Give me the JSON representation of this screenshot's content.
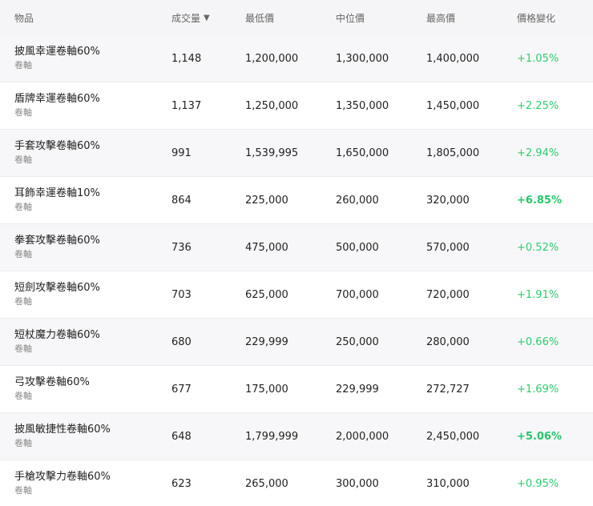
{
  "header": {
    "item": "物品",
    "volume": "成交量",
    "sort_icon": "▼",
    "low": "最低價",
    "median": "中位價",
    "high": "最高價",
    "change": "價格變化"
  },
  "rows": [
    {
      "name": "披風幸運卷軸60%",
      "category": "卷軸",
      "volume": "1,148",
      "low": "1,200,000",
      "median": "1,300,000",
      "high": "1,400,000",
      "change": "+1.05%",
      "bold": false
    },
    {
      "name": "盾牌幸運卷軸60%",
      "category": "卷軸",
      "volume": "1,137",
      "low": "1,250,000",
      "median": "1,350,000",
      "high": "1,450,000",
      "change": "+2.25%",
      "bold": false
    },
    {
      "name": "手套攻擊卷軸60%",
      "category": "卷軸",
      "volume": "991",
      "low": "1,539,995",
      "median": "1,650,000",
      "high": "1,805,000",
      "change": "+2.94%",
      "bold": false
    },
    {
      "name": "耳飾幸運卷軸10%",
      "category": "卷軸",
      "volume": "864",
      "low": "225,000",
      "median": "260,000",
      "high": "320,000",
      "change": "+6.85%",
      "bold": true
    },
    {
      "name": "拳套攻擊卷軸60%",
      "category": "卷軸",
      "volume": "736",
      "low": "475,000",
      "median": "500,000",
      "high": "570,000",
      "change": "+0.52%",
      "bold": false
    },
    {
      "name": "短劍攻擊卷軸60%",
      "category": "卷軸",
      "volume": "703",
      "low": "625,000",
      "median": "700,000",
      "high": "720,000",
      "change": "+1.91%",
      "bold": false
    },
    {
      "name": "短杖魔力卷軸60%",
      "category": "卷軸",
      "volume": "680",
      "low": "229,999",
      "median": "250,000",
      "high": "280,000",
      "change": "+0.66%",
      "bold": false
    },
    {
      "name": "弓攻擊卷軸60%",
      "category": "卷軸",
      "volume": "677",
      "low": "175,000",
      "median": "229,999",
      "high": "272,727",
      "change": "+1.69%",
      "bold": false
    },
    {
      "name": "披風敏捷性卷軸60%",
      "category": "卷軸",
      "volume": "648",
      "low": "1,799,999",
      "median": "2,000,000",
      "high": "2,450,000",
      "change": "+5.06%",
      "bold": true
    },
    {
      "name": "手槍攻擊力卷軸60%",
      "category": "卷軸",
      "volume": "623",
      "low": "265,000",
      "median": "300,000",
      "high": "310,000",
      "change": "+0.95%",
      "bold": false
    }
  ]
}
